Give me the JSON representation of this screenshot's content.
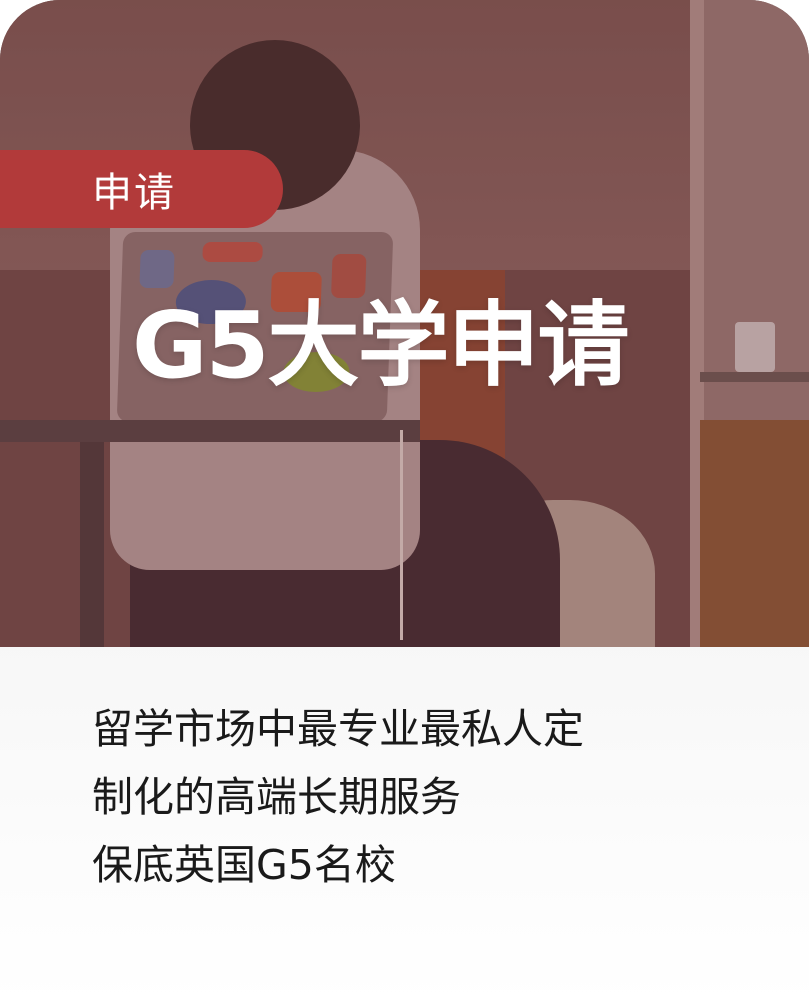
{
  "tag": {
    "label": "申请"
  },
  "hero": {
    "title": "G5大学申请"
  },
  "description": {
    "lines": [
      "留学市场中最专业最私人定",
      "制化的高端长期服务",
      "保底英国G5名校"
    ]
  },
  "colors": {
    "tag_background": "#b23a3a",
    "title_text": "#ffffff",
    "description_text": "#1a1a1a"
  }
}
